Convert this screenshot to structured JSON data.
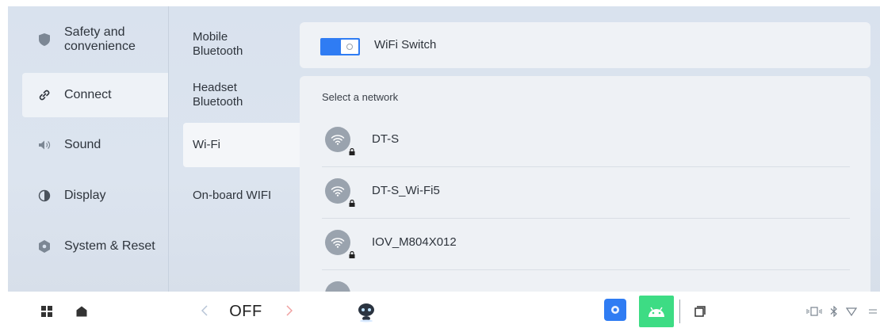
{
  "nav": {
    "items": [
      {
        "label": "Safety and\nconvenience",
        "icon": "shield-icon",
        "active": false
      },
      {
        "label": "Connect",
        "icon": "link-icon",
        "active": true
      },
      {
        "label": "Sound",
        "icon": "speaker-icon",
        "active": false
      },
      {
        "label": "Display",
        "icon": "contrast-icon",
        "active": false
      },
      {
        "label": "System & Reset",
        "icon": "system-reset-icon",
        "active": false
      }
    ]
  },
  "subnav": {
    "items": [
      {
        "label": "Mobile\nBluetooth",
        "active": false
      },
      {
        "label": "Headset\nBluetooth",
        "active": false
      },
      {
        "label": "Wi-Fi",
        "active": true
      },
      {
        "label": "On-board WIFI",
        "active": false
      }
    ]
  },
  "wifi": {
    "switch_label": "WiFi Switch",
    "switch_on": true,
    "select_label": "Select a network",
    "networks": [
      {
        "name": "DT-S",
        "secured": true
      },
      {
        "name": "DT-S_Wi-Fi5",
        "secured": true
      },
      {
        "name": "IOV_M804X012",
        "secured": true
      }
    ]
  },
  "taskbar": {
    "off_label": "OFF",
    "icons": [
      "apps-grid-icon",
      "home-icon",
      "chevron-left-icon",
      "chevron-right-icon",
      "robot-assistant-icon",
      "settings-app-icon",
      "android-app-icon",
      "recent-apps-icon",
      "phone-signal-icon",
      "bluetooth-icon",
      "wifi-status-icon"
    ]
  },
  "colors": {
    "accent": "#2f7cf3",
    "android_green": "#3ddc84",
    "settings_blue": "#2f7cf3",
    "background": "#d9e2ee"
  }
}
